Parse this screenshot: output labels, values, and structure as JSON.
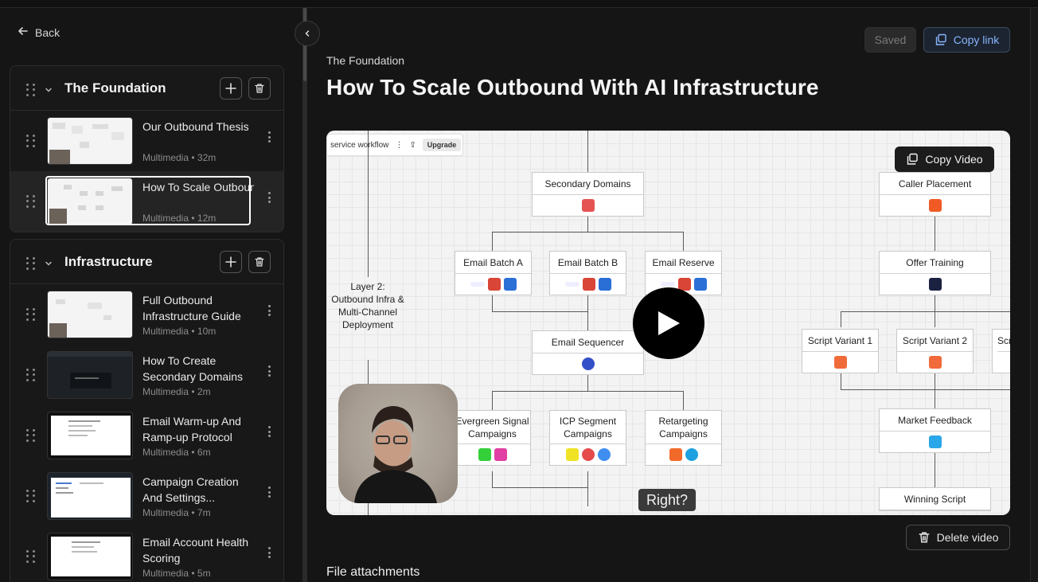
{
  "sidebar": {
    "back_label": "Back",
    "sections": [
      {
        "title": "The Foundation",
        "items": [
          {
            "title": "Our Outbound Thesis",
            "meta": "Multimedia • 32m"
          },
          {
            "title": "How To Scale Outbound With AI...",
            "meta": "Multimedia • 12m"
          }
        ]
      },
      {
        "title": "Infrastructure",
        "items": [
          {
            "title": "Full Outbound Infrastructure Guide",
            "meta": "Multimedia • 10m"
          },
          {
            "title": "How To Create Secondary Domains",
            "meta": "Multimedia • 2m"
          },
          {
            "title": "Email Warm-up And Ramp-up Protocol",
            "meta": "Multimedia • 6m"
          },
          {
            "title": "Campaign Creation And Settings...",
            "meta": "Multimedia • 7m"
          },
          {
            "title": "Email Account Health Scoring",
            "meta": "Multimedia • 5m"
          }
        ]
      }
    ]
  },
  "header": {
    "saved_label": "Saved",
    "copy_link_label": "Copy link",
    "breadcrumb": "The Foundation",
    "title": "How To Scale Outbound With AI Infrastructure"
  },
  "video": {
    "copy_video_label": "Copy Video",
    "caption": "Right?",
    "toolbar_text": "service workflow",
    "toolbar_upgrade": "Upgrade",
    "layer_label": "Layer 2: Outbound Infra & Multi-Channel Deployment",
    "nodes": {
      "secondary_domains": "Secondary Domains",
      "email_batch_a": "Email Batch A",
      "email_batch_b": "Email Batch B",
      "email_reserve": "Email Reserve",
      "email_sequencer": "Email Sequencer",
      "evergreen": "Evergreen Signal Campaigns",
      "icp_segment": "ICP Segment Campaigns",
      "retargeting": "Retargeting Campaigns",
      "caller_placement": "Caller Placement",
      "offer_training": "Offer Training",
      "script_variant_1": "Script Variant 1",
      "script_variant_2": "Script Variant 2",
      "script_variant_3": "Scr",
      "market_feedback": "Market Feedback",
      "winning_script": "Winning Script"
    },
    "colors": {
      "accent_blue": "#8ab4ff"
    }
  },
  "footer": {
    "delete_label": "Delete video",
    "attachments_label": "File attachments"
  }
}
